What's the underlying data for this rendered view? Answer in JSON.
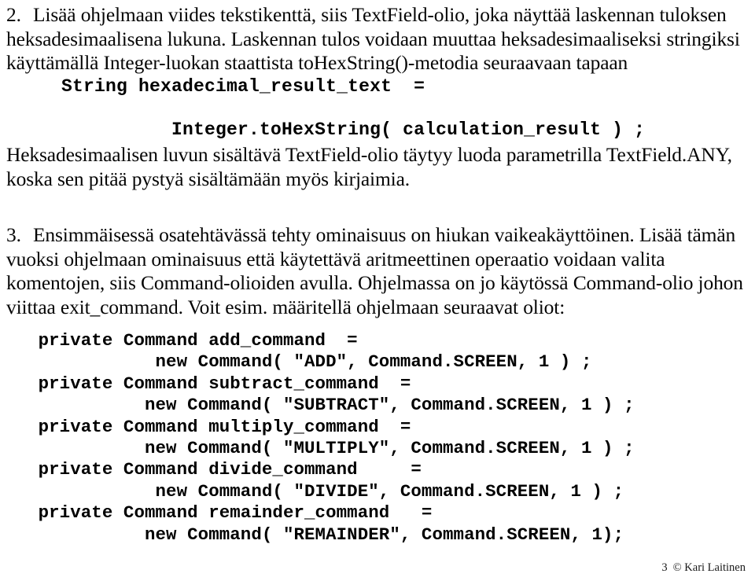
{
  "document": {
    "language": "fi",
    "page_number": "3",
    "copyright": "© Kari Laitinen"
  },
  "items": [
    {
      "marker": "2.",
      "paragraphs": [
        "Lisää ohjelmaan viides tekstikenttä, siis TextField-olio, joka näyttää laskennan tuloksen heksadesimaalisena lukuna. Laskennan tulos voidaan muuttaa heksadesimaaliseksi stringiksi käyttämällä Integer-luokan staattista toHexString()-metodia seuraavaan tapaan"
      ],
      "code_block": "     String hexadecimal_result_text  =\n\n               Integer.toHexString( calculation_result ) ;",
      "after_text": "Heksadesimaalisen luvun sisältävä TextField-olio täytyy luoda parametrilla TextField.ANY, koska sen pitää pystyä sisältämään myös kirjaimia."
    },
    {
      "marker": "3.",
      "paragraphs": [
        "Ensimmäisessä osatehtävässä tehty ominaisuus on hiukan vaikeakäyttöinen. Lisää tämän vuoksi ohjelmaan ominaisuus että käytettävä aritmeettinen operaatio voidaan valita komentojen, siis Command-olioiden avulla. Ohjelmassa on jo käytössä Command-olio johon viittaa exit_command. Voit esim. määritellä ohjelmaan seuraavat oliot:"
      ],
      "code_block": "   private Command add_command  =\n              new Command( \"ADD\", Command.SCREEN, 1 ) ;\n   private Command subtract_command  =\n             new Command( \"SUBTRACT\", Command.SCREEN, 1 ) ;\n   private Command multiply_command  =\n             new Command( \"MULTIPLY\", Command.SCREEN, 1 ) ;\n   private Command divide_command     =\n              new Command( \"DIVIDE\", Command.SCREEN, 1 ) ;\n   private Command remainder_command   =\n             new Command( \"REMAINDER\", Command.SCREEN, 1);"
    }
  ],
  "footer": {
    "page": "3",
    "credit": "© Kari Laitinen"
  }
}
